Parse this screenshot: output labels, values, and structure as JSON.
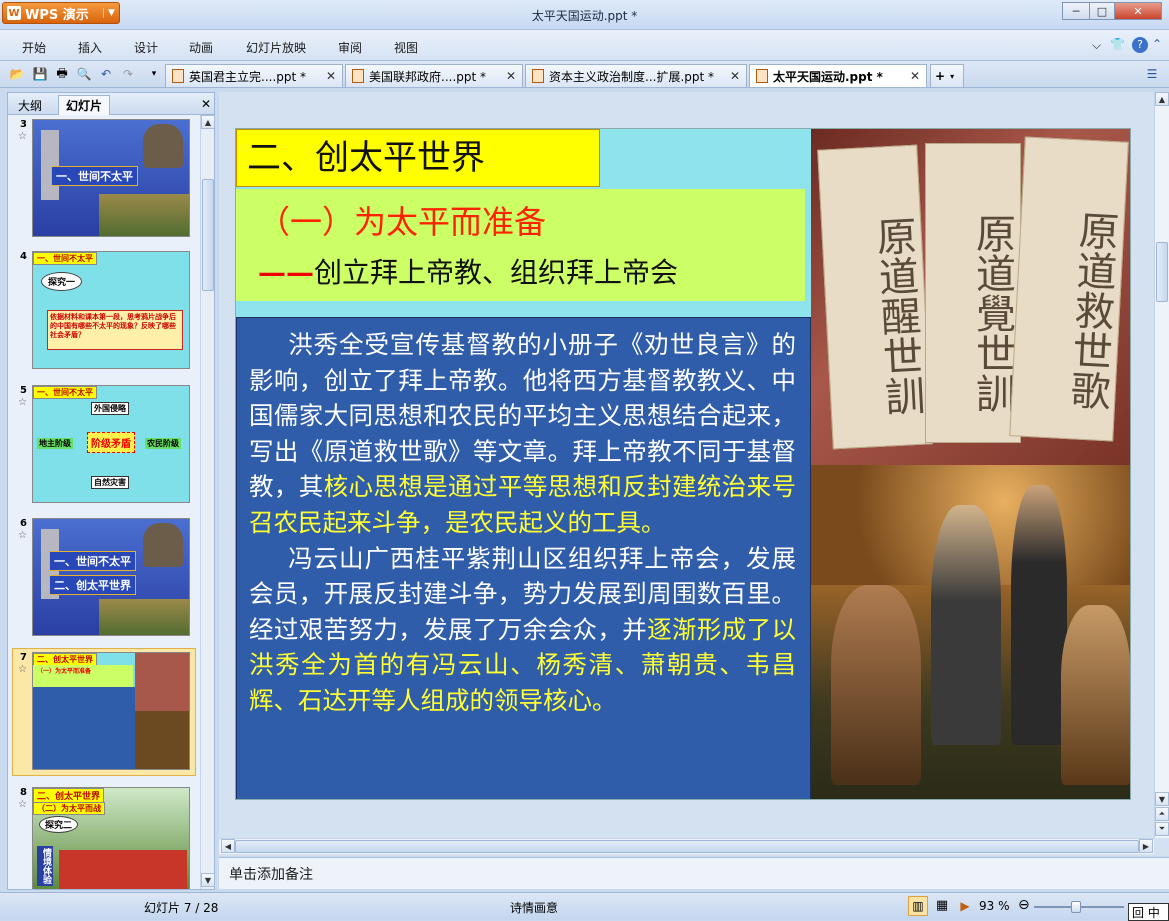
{
  "app": {
    "name": "WPS 演示",
    "window_title": "太平天国运动.ppt *"
  },
  "menu": [
    "开始",
    "插入",
    "设计",
    "动画",
    "幻灯片放映",
    "审阅",
    "视图"
  ],
  "doc_tabs": [
    {
      "label": "英国君主立完....ppt *",
      "active": false
    },
    {
      "label": "美国联邦政府....ppt *",
      "active": false
    },
    {
      "label": "资本主义政治制度...扩展.ppt *",
      "active": false
    },
    {
      "label": "太平天国运动.ppt *",
      "active": true
    }
  ],
  "panel": {
    "tabs": [
      "大纲",
      "幻灯片"
    ],
    "active_tab": "幻灯片"
  },
  "thumbnails": [
    {
      "num": "3",
      "tags": [
        "一、世间不太平"
      ]
    },
    {
      "num": "4",
      "tags": [
        "一、世间不太平",
        "探究一",
        "依据材料和课本第一段，思考鸦片战争后的中国有哪些不太平的现象？反映了哪些社会矛盾？"
      ]
    },
    {
      "num": "5",
      "tags": [
        "一、世间不太平",
        "外国侵略",
        "地主阶级",
        "阶级矛盾",
        "农民阶级",
        "自然灾害"
      ]
    },
    {
      "num": "6",
      "tags": [
        "一、世间不太平",
        "二、创太平世界"
      ]
    },
    {
      "num": "7",
      "tags": [
        "二、创太平世界",
        "（一）为太平而准备"
      ]
    },
    {
      "num": "8",
      "tags": [
        "二、创太平世界",
        "（二）为太平而战",
        "探究二",
        "情境体验"
      ]
    }
  ],
  "slide": {
    "title": "二、创太平世界",
    "subtitle": "（一）为太平而准备",
    "subtitle2_dash": "——",
    "subtitle2": "创立拜上帝教、组织拜上帝会",
    "para1_a": "洪秀全受宣传基督教的小册子《劝世良言》的影响，创立了拜上帝教。他将西方基督教教义、中国儒家大同思想和农民的平均主义思想结合起来，写出《原道救世歌》等文章。拜上帝教不同于基督教，其",
    "para1_b": "核心思想是通过平等思想和反封建统治来号召农民起来斗争，是农民起义的工具。",
    "para2_a": "冯云山广西桂平紫荆山区组织拜上帝会，发展会员，开展反封建斗争，势力发展到周围数百里。经过艰苦努力，发展了万余会众，并",
    "para2_b": "逐渐形成了以洪秀全为首的有冯云山、杨秀清、萧朝贵、韦昌辉、石达开等人组成的领导核心。",
    "book_titles": [
      "原道醒世訓",
      "原道覺世訓",
      "原道救世歌"
    ]
  },
  "notes_placeholder": "单击添加备注",
  "status": {
    "slide_counter": "幻灯片 7 / 28",
    "theme": "诗情画意",
    "zoom": "93 %",
    "ime": "中"
  }
}
